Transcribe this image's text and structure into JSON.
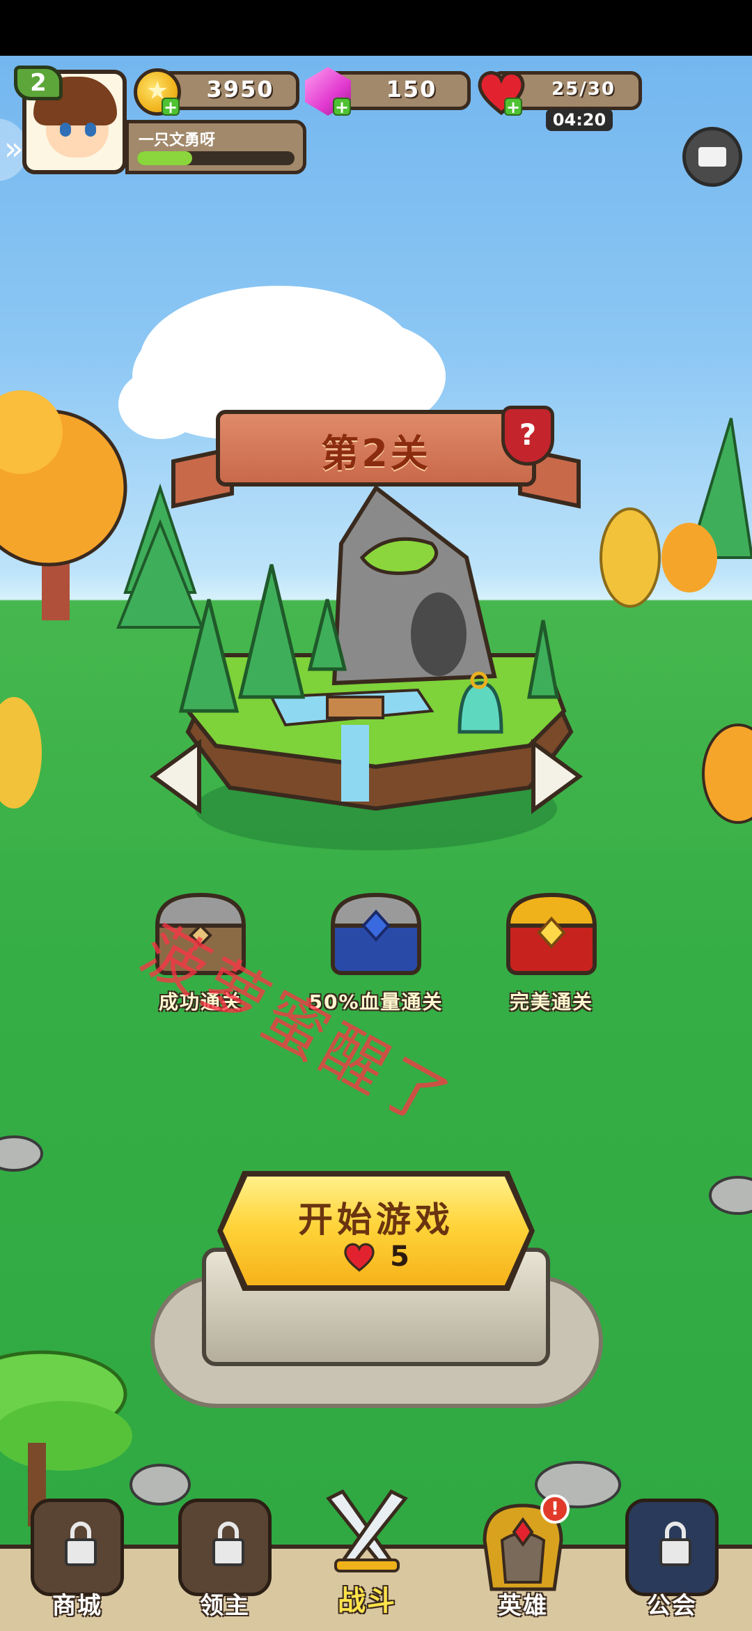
{
  "player": {
    "level": "2",
    "name": "一只文勇呀",
    "exp_fraction": 0.35
  },
  "resources": {
    "coins": "3950",
    "gems": "150",
    "energy": "25/30",
    "energy_timer": "04:20"
  },
  "stage": {
    "title": "第2关"
  },
  "rewards": [
    {
      "label": "成功通关"
    },
    {
      "label": "50%血量通关"
    },
    {
      "label": "完美通关"
    }
  ],
  "watermark": "菠萝蜜醒了",
  "start": {
    "label": "开始游戏",
    "cost": "5"
  },
  "nav": [
    {
      "label": "商城",
      "locked": true
    },
    {
      "label": "领主",
      "locked": true
    },
    {
      "label": "战斗",
      "active": true
    },
    {
      "label": "英雄",
      "alert": "!"
    },
    {
      "label": "公会",
      "locked": true
    }
  ],
  "colors": {
    "sky": "#8cc7f4",
    "grass": "#35ae45",
    "panel": "#a2896b",
    "button_yellow": "#ffd43a",
    "heart_red": "#e2232f",
    "watermark_red": "#ff3344"
  },
  "icons": {
    "coin": "coin-icon",
    "gem": "gem-icon",
    "heart": "heart-icon",
    "mail": "mail-icon",
    "help": "question-shield-icon",
    "lock": "lock-icon",
    "battle": "crossed-swords-icon",
    "hero": "helmet-icon"
  }
}
